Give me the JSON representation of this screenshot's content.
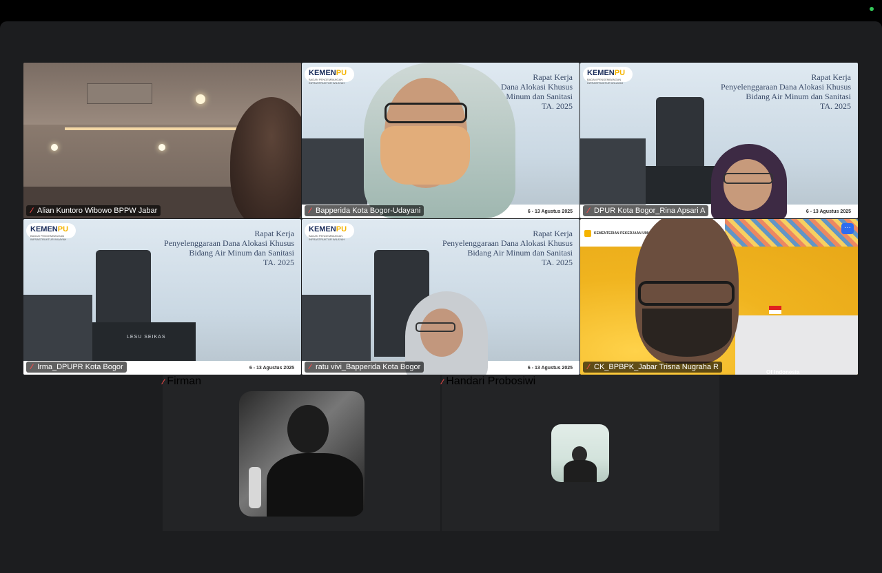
{
  "slide": {
    "logo_text": "KEMEN",
    "logo_accent": "PU",
    "logo_sub": "BADAN PENGEMBANGAN INFRASTRUKTUR WILAYAH",
    "title_line1": "Rapat Kerja",
    "title_line2": "Penyelenggaraan Dana Alokasi Khusus",
    "title_line3": "Bidang Air Minum dan Sanitasi",
    "title_line4": "TA. 2025",
    "date": "6 - 13 Agustus 2025"
  },
  "participants": [
    {
      "name": "Alian Kuntoro Wibowo BPPW Jabar",
      "muted": true
    },
    {
      "name": "Bapperida Kota Bogor-Udayani",
      "muted": true
    },
    {
      "name": "DPUR Kota Bogor_Rina Apsari A",
      "muted": true
    },
    {
      "name": "Irma_DPUPR Kota Bogor",
      "muted": true
    },
    {
      "name": "ratu vivi_Bapperida Kota Bogor",
      "muted": true
    },
    {
      "name": "CK_BPBPK_Jabar Trisna Nugraha R",
      "muted": true
    },
    {
      "name": "Firman",
      "muted": true
    },
    {
      "name": "Handari Probosiwi",
      "muted": true
    }
  ],
  "ck_tile": {
    "banner_text": "KEMENTERIAN PEKERJAAN UMUM",
    "caption": "Of Indonesia"
  },
  "tile_label": "LESU SEIKAS",
  "more_button_label": "···",
  "colors": {
    "stage_bg": "#1c1d1f",
    "mute_red": "#ff4a4a",
    "status_green": "#34c759",
    "accent_blue": "#2d6cf0"
  }
}
